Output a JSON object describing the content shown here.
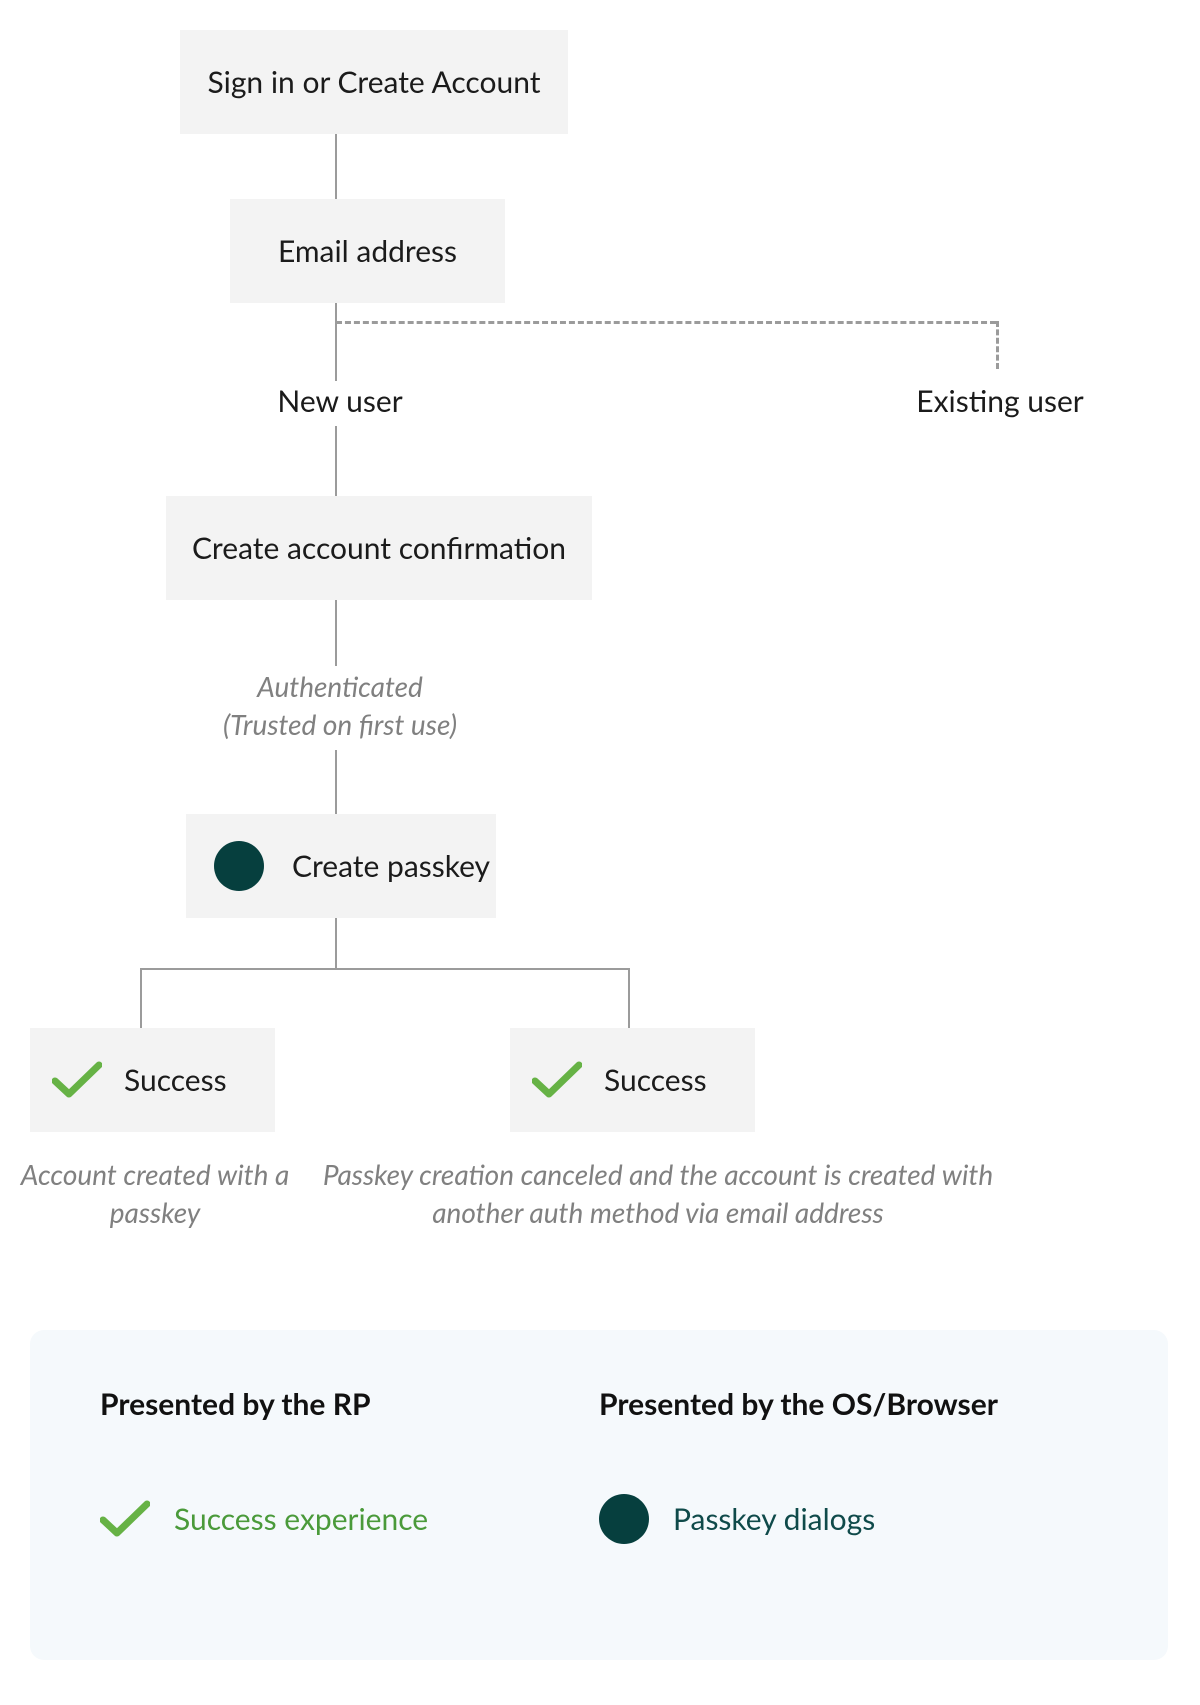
{
  "colors": {
    "node_bg": "#f3f3f3",
    "connector": "#9b9b9b",
    "caption": "#808080",
    "passkey_dot": "#063f3e",
    "success_check": "#66b245",
    "legend_bg": "#f5f9fc",
    "legend_success_text": "#4a9a3a",
    "legend_passkey_text": "#0f4a4a"
  },
  "nodes": {
    "sign_in": "Sign in or Create Account",
    "email": "Email address",
    "new_user": "New user",
    "existing_user": "Existing user",
    "create_confirmation": "Create account confirmation",
    "authenticated_line1": "Authenticated",
    "authenticated_line2": "(Trusted on first use)",
    "create_passkey": "Create passkey",
    "success_left": "Success",
    "success_right": "Success"
  },
  "captions": {
    "left": "Account created with a passkey",
    "right": "Passkey creation canceled and the account is created with another auth method via email address"
  },
  "legend": {
    "heading_rp": "Presented by the RP",
    "heading_os": "Presented by the OS/Browser",
    "success_experience": "Success experience",
    "passkey_dialogs": "Passkey dialogs"
  }
}
